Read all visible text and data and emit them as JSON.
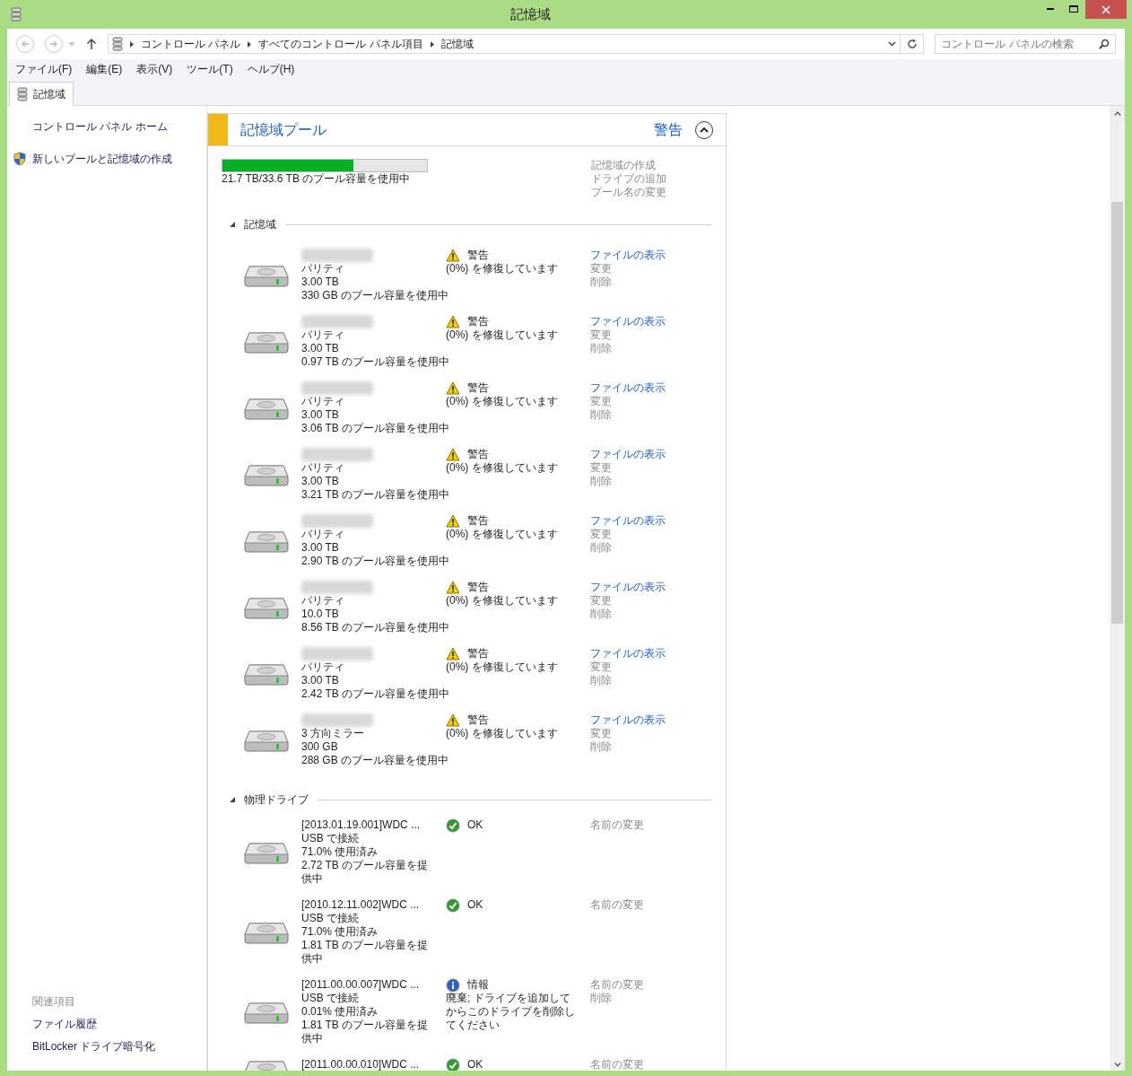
{
  "window": {
    "title": "記憶域"
  },
  "address_bar": {
    "path": [
      "コントロール パネル",
      "すべてのコントロール パネル項目",
      "記憶域"
    ]
  },
  "search": {
    "placeholder": "コントロール パネルの検索"
  },
  "menu": [
    "ファイル(F)",
    "編集(E)",
    "表示(V)",
    "ツール(T)",
    "ヘルプ(H)"
  ],
  "tabs": [
    {
      "label": "記憶域",
      "selected": true
    }
  ],
  "sidebar": {
    "items": [
      {
        "kind": "link",
        "label": "コントロール パネル ホーム"
      },
      {
        "kind": "admin",
        "label": "新しいプールと記憶域の作成"
      }
    ],
    "related": {
      "title": "関連項目",
      "links": [
        "ファイル履歴",
        "BitLocker ドライブ暗号化"
      ]
    }
  },
  "pool": {
    "title": "記憶域プール",
    "status": "警告",
    "expanded": true,
    "usage": {
      "level": 0.64,
      "text": "21.7 TB/33.6 TB のプール容量を使用中"
    },
    "actions": [
      "記憶域の作成",
      "ドライブの追加",
      "プール名の変更"
    ],
    "sections": [
      {
        "kind": "spaces",
        "title": "記憶域",
        "expanded": true,
        "items": [
          {
            "lines": [
              "パリティ",
              "3.00 TB",
              "330 GB のプール容量を使用中"
            ],
            "status": {
              "kind": "warning",
              "label": "警告",
              "detail": "(0%) を修復しています"
            },
            "actions": [
              {
                "label": "ファイルの表示",
                "enabled": true
              },
              {
                "label": "変更",
                "enabled": false
              },
              {
                "label": "削除",
                "enabled": false
              }
            ]
          },
          {
            "lines": [
              "パリティ",
              "3.00 TB",
              "0.97 TB のプール容量を使用中"
            ],
            "status": {
              "kind": "warning",
              "label": "警告",
              "detail": "(0%) を修復しています"
            },
            "actions": [
              {
                "label": "ファイルの表示",
                "enabled": true
              },
              {
                "label": "変更",
                "enabled": false
              },
              {
                "label": "削除",
                "enabled": false
              }
            ]
          },
          {
            "lines": [
              "パリティ",
              "3.00 TB",
              "3.06 TB のプール容量を使用中"
            ],
            "status": {
              "kind": "warning",
              "label": "警告",
              "detail": "(0%) を修復しています"
            },
            "actions": [
              {
                "label": "ファイルの表示",
                "enabled": true
              },
              {
                "label": "変更",
                "enabled": false
              },
              {
                "label": "削除",
                "enabled": false
              }
            ]
          },
          {
            "lines": [
              "パリティ",
              "3.00 TB",
              "3.21 TB のプール容量を使用中"
            ],
            "status": {
              "kind": "warning",
              "label": "警告",
              "detail": "(0%) を修復しています"
            },
            "actions": [
              {
                "label": "ファイルの表示",
                "enabled": true
              },
              {
                "label": "変更",
                "enabled": false
              },
              {
                "label": "削除",
                "enabled": false
              }
            ]
          },
          {
            "lines": [
              "パリティ",
              "3.00 TB",
              "2.90 TB のプール容量を使用中"
            ],
            "status": {
              "kind": "warning",
              "label": "警告",
              "detail": "(0%) を修復しています"
            },
            "actions": [
              {
                "label": "ファイルの表示",
                "enabled": true
              },
              {
                "label": "変更",
                "enabled": false
              },
              {
                "label": "削除",
                "enabled": false
              }
            ]
          },
          {
            "lines": [
              "パリティ",
              "10.0 TB",
              "8.56 TB のプール容量を使用中"
            ],
            "status": {
              "kind": "warning",
              "label": "警告",
              "detail": "(0%) を修復しています"
            },
            "actions": [
              {
                "label": "ファイルの表示",
                "enabled": true
              },
              {
                "label": "変更",
                "enabled": false
              },
              {
                "label": "削除",
                "enabled": false
              }
            ]
          },
          {
            "lines": [
              "パリティ",
              "3.00 TB",
              "2.42 TB のプール容量を使用中"
            ],
            "status": {
              "kind": "warning",
              "label": "警告",
              "detail": "(0%) を修復しています"
            },
            "actions": [
              {
                "label": "ファイルの表示",
                "enabled": true
              },
              {
                "label": "変更",
                "enabled": false
              },
              {
                "label": "削除",
                "enabled": false
              }
            ]
          },
          {
            "lines": [
              "3 方向ミラー",
              "300 GB",
              "288 GB のプール容量を使用中"
            ],
            "status": {
              "kind": "warning",
              "label": "警告",
              "detail": "(0%) を修復しています"
            },
            "actions": [
              {
                "label": "ファイルの表示",
                "enabled": true
              },
              {
                "label": "変更",
                "enabled": false
              },
              {
                "label": "削除",
                "enabled": false
              }
            ]
          }
        ]
      },
      {
        "kind": "drives",
        "title": "物理ドライブ",
        "expanded": true,
        "items": [
          {
            "name": "[2013.01.19.001]WDC ...",
            "lines": [
              "USB で接続",
              "71.0% 使用済み",
              "2.72 TB のプール容量を提供中"
            ],
            "status": {
              "kind": "ok",
              "label": "OK"
            },
            "actions": [
              {
                "label": "名前の変更",
                "enabled": false
              }
            ]
          },
          {
            "name": "[2010.12.11.002]WDC ...",
            "lines": [
              "USB で接続",
              "71.0% 使用済み",
              "1.81 TB のプール容量を提供中"
            ],
            "status": {
              "kind": "ok",
              "label": "OK"
            },
            "actions": [
              {
                "label": "名前の変更",
                "enabled": false
              }
            ]
          },
          {
            "name": "[2011.00.00.007]WDC ...",
            "lines": [
              "USB で接続",
              "0.01% 使用済み",
              "1.81 TB のプール容量を提供中"
            ],
            "status": {
              "kind": "info",
              "label": "情報",
              "detail": "廃棄; ドライブを追加してからこのドライブを削除してください"
            },
            "actions": [
              {
                "label": "名前の変更",
                "enabled": false
              },
              {
                "label": "削除",
                "enabled": false
              }
            ]
          },
          {
            "name": "[2011.00.00.010]WDC ...",
            "status": {
              "kind": "ok",
              "label": "OK"
            },
            "actions": [
              {
                "label": "名前の変更",
                "enabled": false
              }
            ]
          }
        ]
      }
    ]
  }
}
